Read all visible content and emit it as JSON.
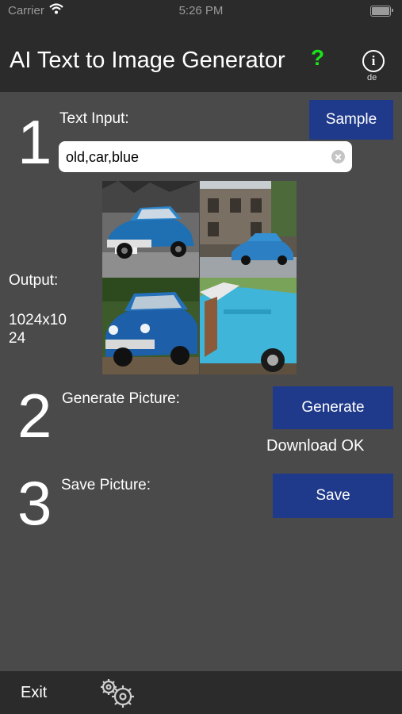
{
  "status": {
    "carrier": "Carrier",
    "time": "5:26 PM"
  },
  "header": {
    "title": "AI Text to Image Generator",
    "help": "?",
    "info": "i",
    "lang": "de"
  },
  "step1": {
    "number": "1",
    "label": "Text Input:",
    "sample_button": "Sample",
    "input_value": "old,car,blue"
  },
  "output": {
    "label": "Output:",
    "size_line1": "1024x10",
    "size_line2": "24"
  },
  "step2": {
    "number": "2",
    "label": "Generate Picture:",
    "button": "Generate",
    "status": "Download OK"
  },
  "step3": {
    "number": "3",
    "label": "Save Picture:",
    "button": "Save"
  },
  "tabbar": {
    "exit": "Exit"
  },
  "colors": {
    "background": "#4a4a4a",
    "bar": "#2b2b2b",
    "button": "#1f3a8a",
    "help": "#19e319"
  },
  "icons": [
    "wifi-icon",
    "battery-icon",
    "info-icon",
    "clear-icon",
    "gears-icon"
  ]
}
